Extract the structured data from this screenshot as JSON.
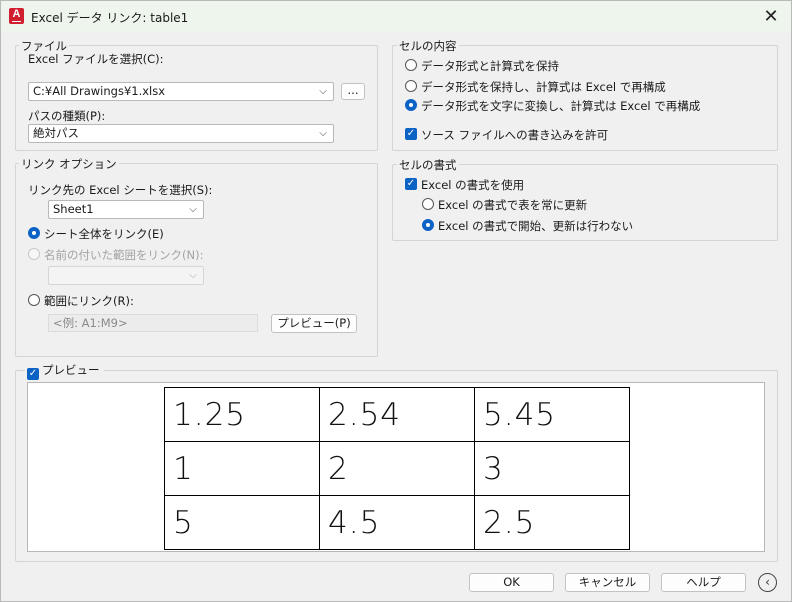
{
  "titlebar": {
    "title": "Excel データ リンク: table1",
    "close": "✕"
  },
  "file_group": {
    "legend": "ファイル",
    "select_label": "Excel ファイルを選択(C):",
    "file_value": "C:¥All Drawings¥1.xlsx",
    "browse_label": "...",
    "path_type_label": "パスの種類(P):",
    "path_type_value": "絶対パス"
  },
  "link_group": {
    "legend": "リンク オプション",
    "sheet_label": "リンク先の Excel シートを選択(S):",
    "sheet_value": "Sheet1",
    "opt_whole": "シート全体をリンク(E)",
    "opt_named": "名前の付いた範囲をリンク(N):",
    "named_value": "",
    "opt_range": "範囲にリンク(R):",
    "range_placeholder": "<例: A1:M9>",
    "preview_btn": "プレビュー(P)"
  },
  "cell_contents": {
    "legend": "セルの内容",
    "opt1": "データ形式と計算式を保持",
    "opt2": "データ形式を保持し、計算式は Excel で再構成",
    "opt3": "データ形式を文字に変換し、計算式は Excel で再構成",
    "allow_write": "ソース ファイルへの書き込みを許可"
  },
  "cell_format": {
    "legend": "セルの書式",
    "use_excel": "Excel の書式を使用",
    "opt_always": "Excel の書式で表を常に更新",
    "opt_start": "Excel の書式で開始、更新は行わない"
  },
  "preview": {
    "legend": "プレビュー",
    "rows": [
      [
        "1.25",
        "2.54",
        "5.45"
      ],
      [
        "1",
        "2",
        "3"
      ],
      [
        "5",
        "4.5",
        "2.5"
      ]
    ]
  },
  "footer": {
    "ok": "OK",
    "cancel": "キャンセル",
    "help": "ヘルプ",
    "back_icon": "‹"
  }
}
